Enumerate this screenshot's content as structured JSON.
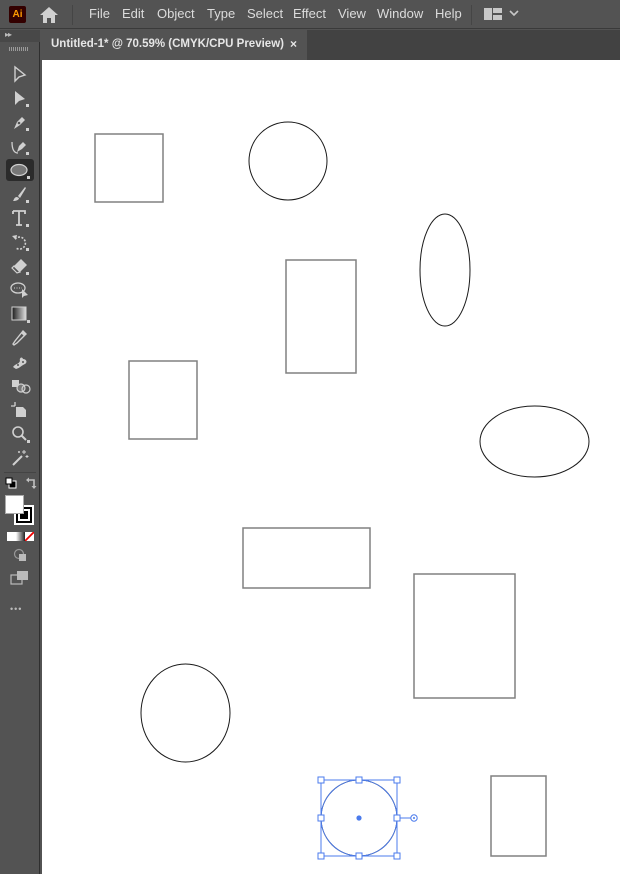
{
  "app": {
    "logo_text": "Ai",
    "menu": [
      "File",
      "Edit",
      "Object",
      "Type",
      "Select",
      "Effect",
      "View",
      "Window",
      "Help"
    ]
  },
  "document_tab": {
    "title": "Untitled-1* @ 70.59% (CMYK/CPU Preview)",
    "close_glyph": "×"
  },
  "toolbar": {
    "tools": [
      {
        "name": "selection-tool",
        "active": false
      },
      {
        "name": "direct-selection-tool",
        "active": false
      },
      {
        "name": "pen-tool",
        "active": false
      },
      {
        "name": "curvature-tool",
        "active": false
      },
      {
        "name": "ellipse-tool",
        "active": true
      },
      {
        "name": "paintbrush-tool",
        "active": false
      },
      {
        "name": "type-tool",
        "active": false
      },
      {
        "name": "rotate-tool",
        "active": false
      },
      {
        "name": "eraser-tool",
        "active": false
      },
      {
        "name": "lasso-tool",
        "active": false
      },
      {
        "name": "gradient-tool",
        "active": false
      },
      {
        "name": "eyedropper-tool",
        "active": false
      },
      {
        "name": "puppet-warp-tool",
        "active": false
      },
      {
        "name": "shape-builder-tool",
        "active": false
      },
      {
        "name": "artboard-tool",
        "active": false
      },
      {
        "name": "zoom-tool",
        "active": false
      },
      {
        "name": "magic-wand-tool",
        "active": false
      }
    ],
    "fill_color": "#ffffff",
    "stroke_color": "#000000",
    "more_glyph": "•••"
  },
  "canvas": {
    "shapes": [
      {
        "type": "rect",
        "label": "rectangle-1"
      },
      {
        "type": "ellipse",
        "label": "circle-1"
      },
      {
        "type": "ellipse",
        "label": "ellipse-tall"
      },
      {
        "type": "rect",
        "label": "rectangle-2"
      },
      {
        "type": "rect",
        "label": "rectangle-3"
      },
      {
        "type": "ellipse",
        "label": "ellipse-wide"
      },
      {
        "type": "rect",
        "label": "rectangle-4"
      },
      {
        "type": "rect",
        "label": "rectangle-5"
      },
      {
        "type": "ellipse",
        "label": "ellipse-3"
      },
      {
        "type": "rect",
        "label": "rectangle-6"
      },
      {
        "type": "ellipse",
        "label": "selected-circle",
        "selected": true
      }
    ],
    "selection_color": "#4b7bec",
    "rect_stroke": "#808080",
    "ellipse_stroke": "#1a1a1a"
  }
}
